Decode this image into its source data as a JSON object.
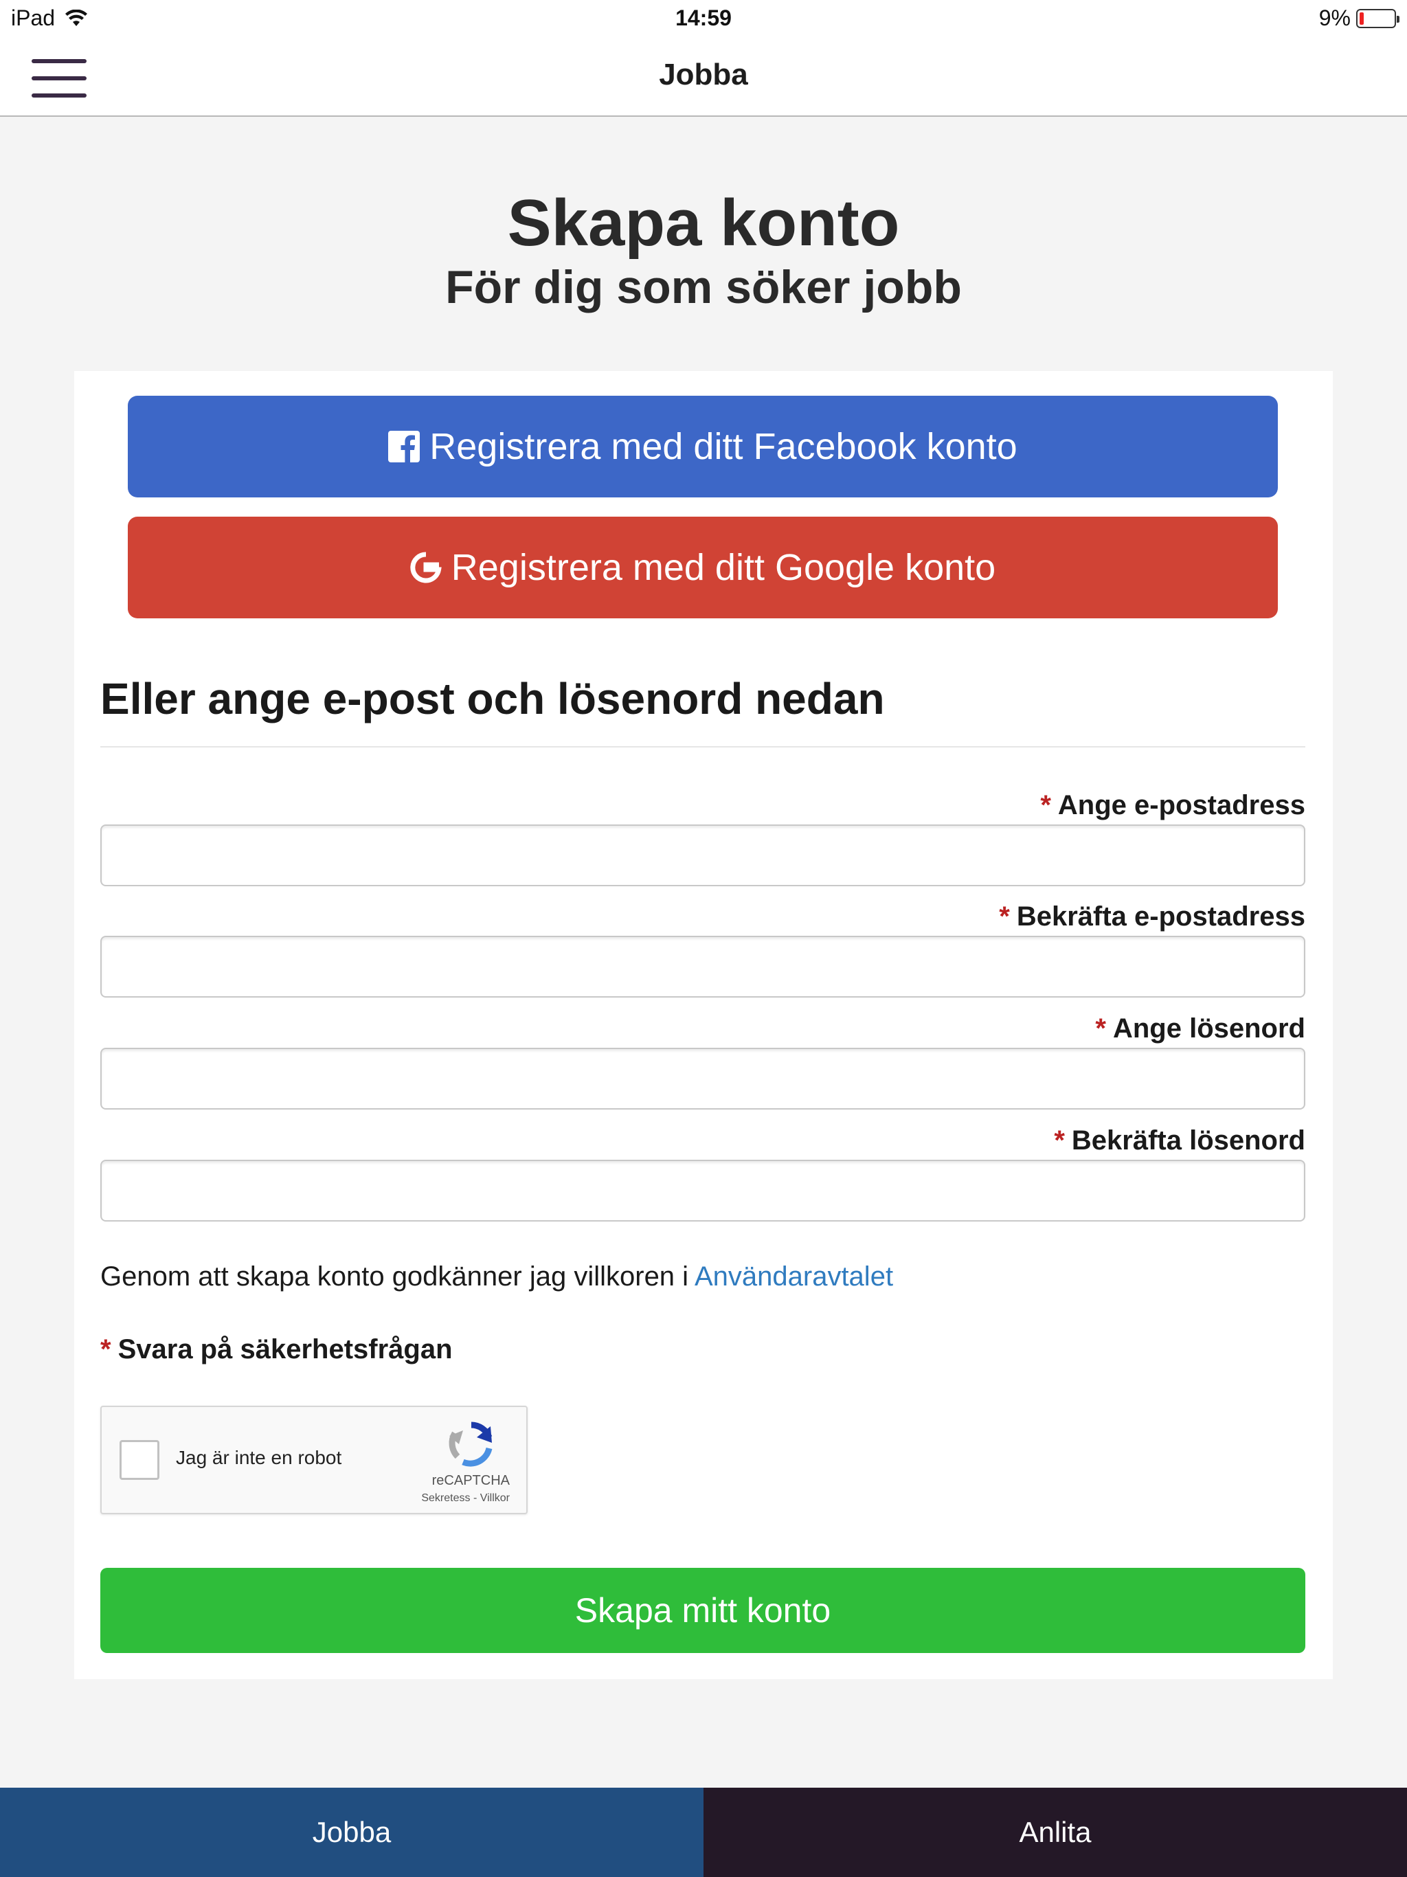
{
  "status_bar": {
    "carrier": "iPad",
    "time": "14:59",
    "battery": "9%"
  },
  "navbar": {
    "title": "Jobba",
    "menu_icon": "hamburger-menu-icon"
  },
  "page": {
    "title": "Skapa konto",
    "subtitle": "För dig som söker jobb"
  },
  "social": {
    "facebook_label": "Registrera med ditt Facebook konto",
    "google_label": "Registrera med ditt Google konto"
  },
  "form": {
    "section_heading": "Eller ange e-post och lösenord nedan",
    "required_marker": "*",
    "fields": [
      {
        "label": "Ange e-postadress",
        "value": ""
      },
      {
        "label": "Bekräfta e-postadress",
        "value": ""
      },
      {
        "label": "Ange lösenord",
        "value": ""
      },
      {
        "label": "Bekräfta lösenord",
        "value": ""
      }
    ],
    "terms_text": "Genom att skapa konto godkänner jag villkoren i ",
    "terms_link": "Användaravtalet",
    "captcha_label": "Svara på säkerhetsfrågan",
    "submit_label": "Skapa mitt konto"
  },
  "recaptcha": {
    "checkbox_label": "Jag är inte en robot",
    "brand": "reCAPTCHA",
    "links": "Sekretess - Villkor"
  },
  "tabs": [
    {
      "label": "Jobba",
      "active": true
    },
    {
      "label": "Anlita",
      "active": false
    }
  ],
  "colors": {
    "facebook": "#3d67c7",
    "google": "#d04335",
    "submit": "#2fbd3a",
    "link": "#2f7bbf",
    "required": "#bb2222",
    "tab_active": "#214e80",
    "tab_inactive": "#241827"
  }
}
